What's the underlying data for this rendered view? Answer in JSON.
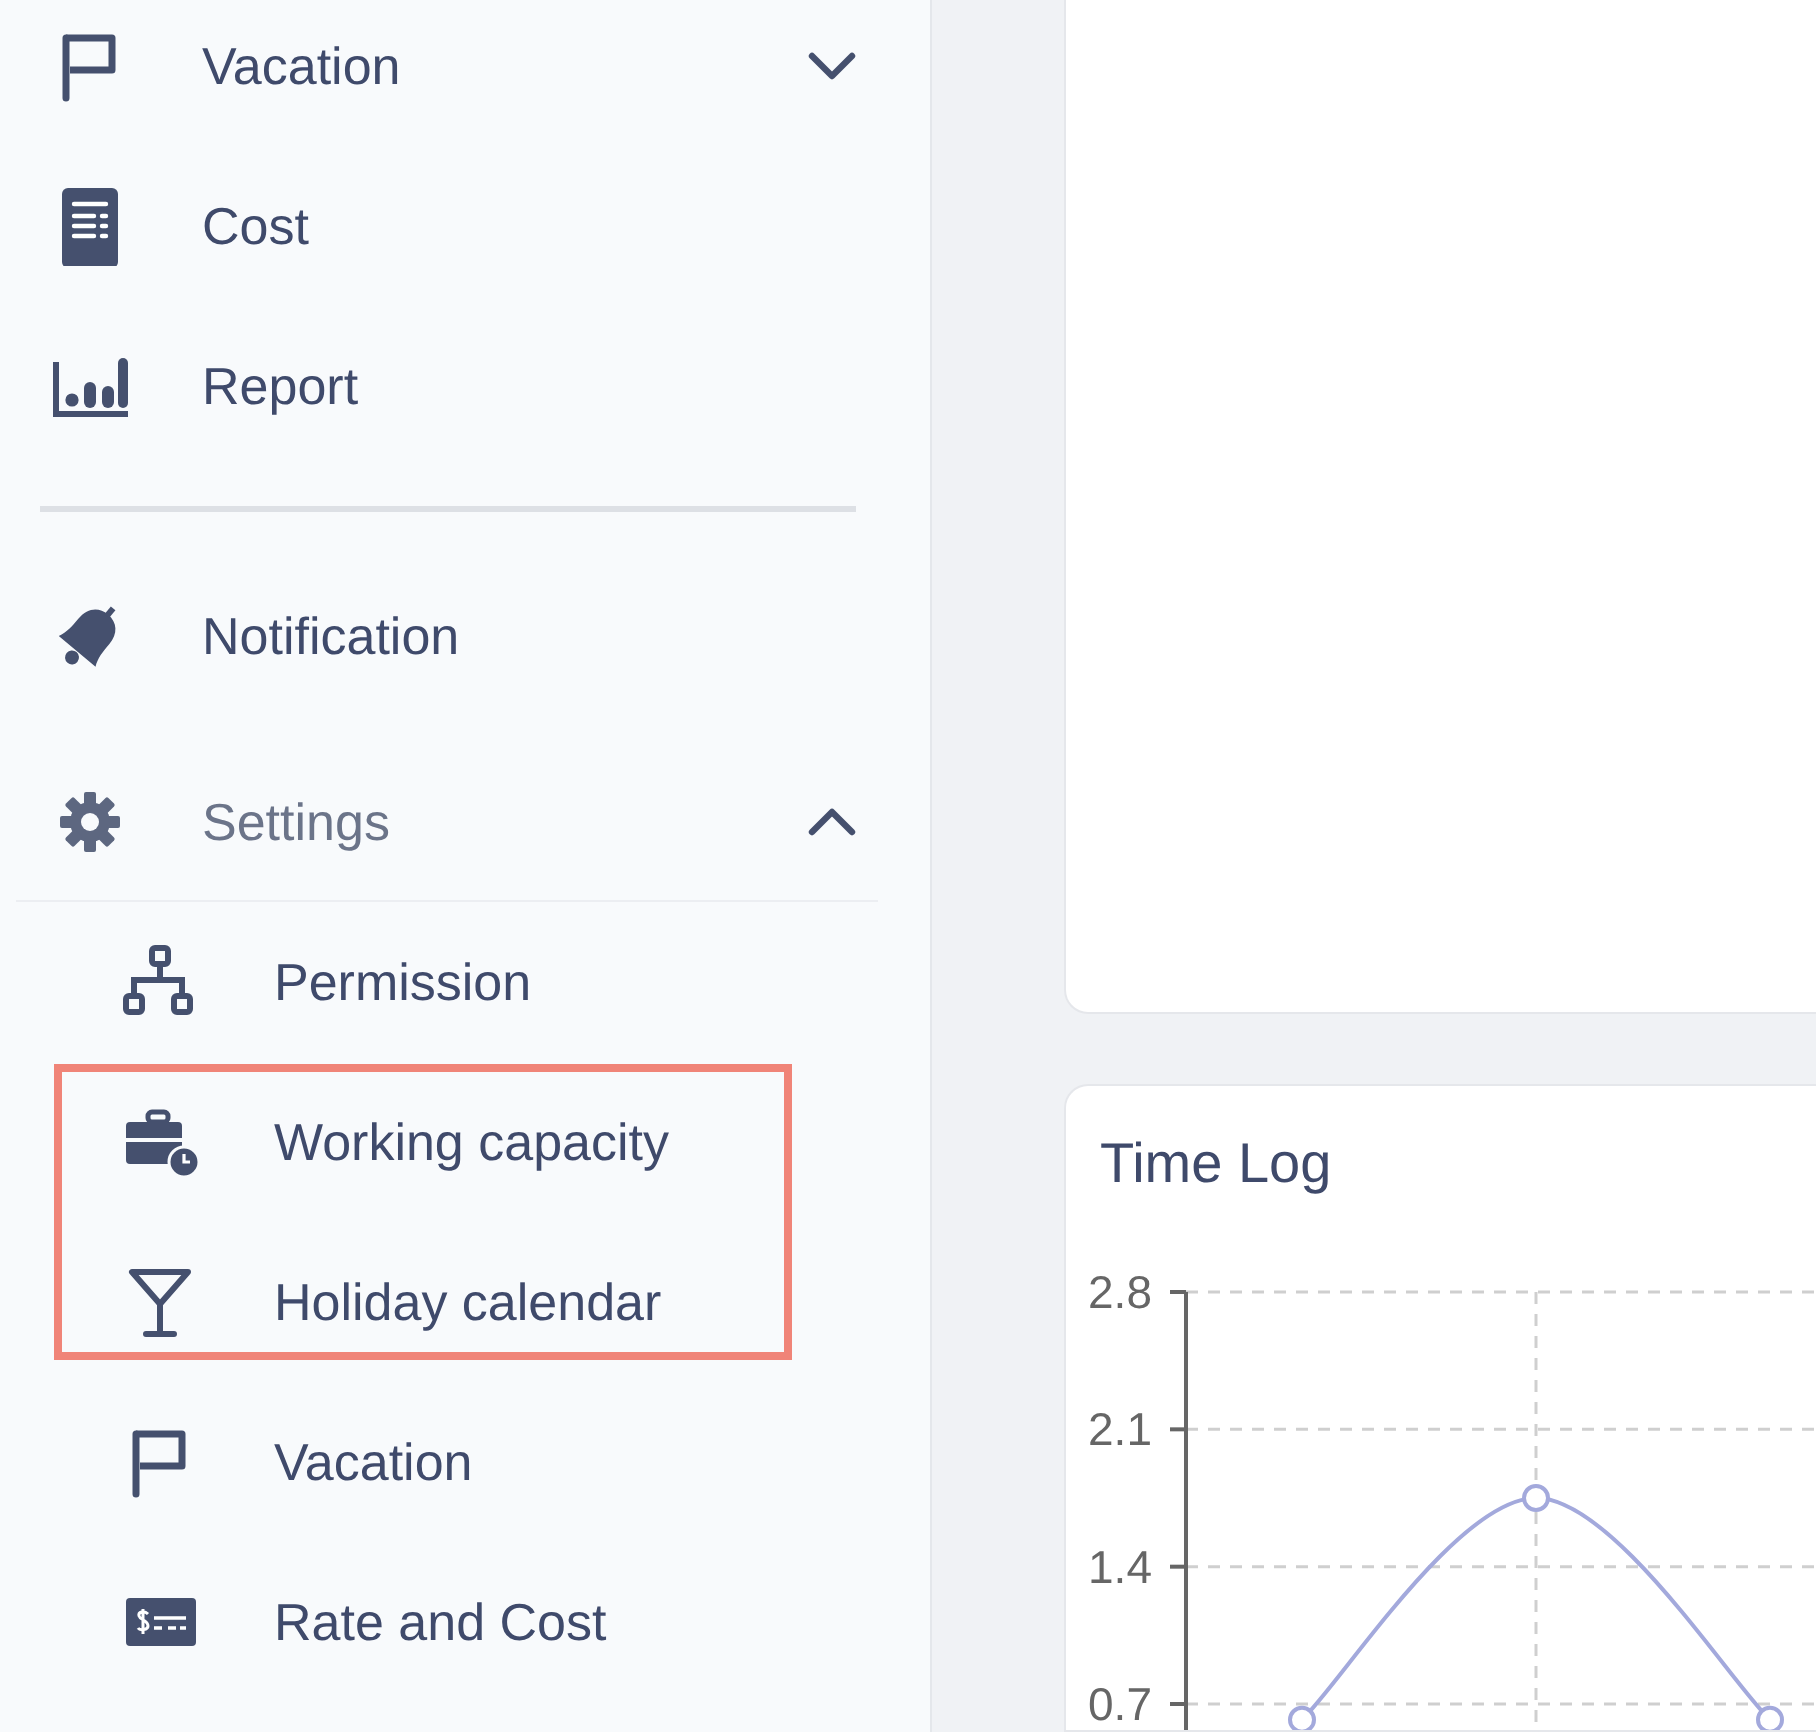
{
  "sidebar": {
    "sections": [
      {
        "items": [
          {
            "label": "Vacation",
            "expanded": false
          },
          {
            "label": "Cost"
          },
          {
            "label": "Report"
          }
        ]
      },
      {
        "items": [
          {
            "label": "Notification"
          },
          {
            "label": "Settings",
            "expanded": true,
            "children": [
              {
                "label": "Permission",
                "highlighted": false
              },
              {
                "label": "Working capacity",
                "highlighted": true
              },
              {
                "label": "Holiday calendar",
                "highlighted": true
              },
              {
                "label": "Vacation",
                "highlighted": false
              },
              {
                "label": "Rate and Cost",
                "highlighted": false
              }
            ]
          }
        ]
      }
    ]
  },
  "time_log": {
    "title": "Time Log",
    "chart_data": {
      "type": "line",
      "yticks": [
        {
          "value": 0.7,
          "label": "0.7"
        },
        {
          "value": 1.4,
          "label": "1.4"
        },
        {
          "value": 2.1,
          "label": "2.1"
        },
        {
          "value": 2.8,
          "label": "2.8"
        }
      ],
      "ylim": [
        0.1,
        2.8
      ],
      "grid": true,
      "series": [
        {
          "color": "#a3a9dc",
          "marker": "circle",
          "values": [
            0.62,
            1.75,
            0.62
          ]
        }
      ]
    }
  }
}
